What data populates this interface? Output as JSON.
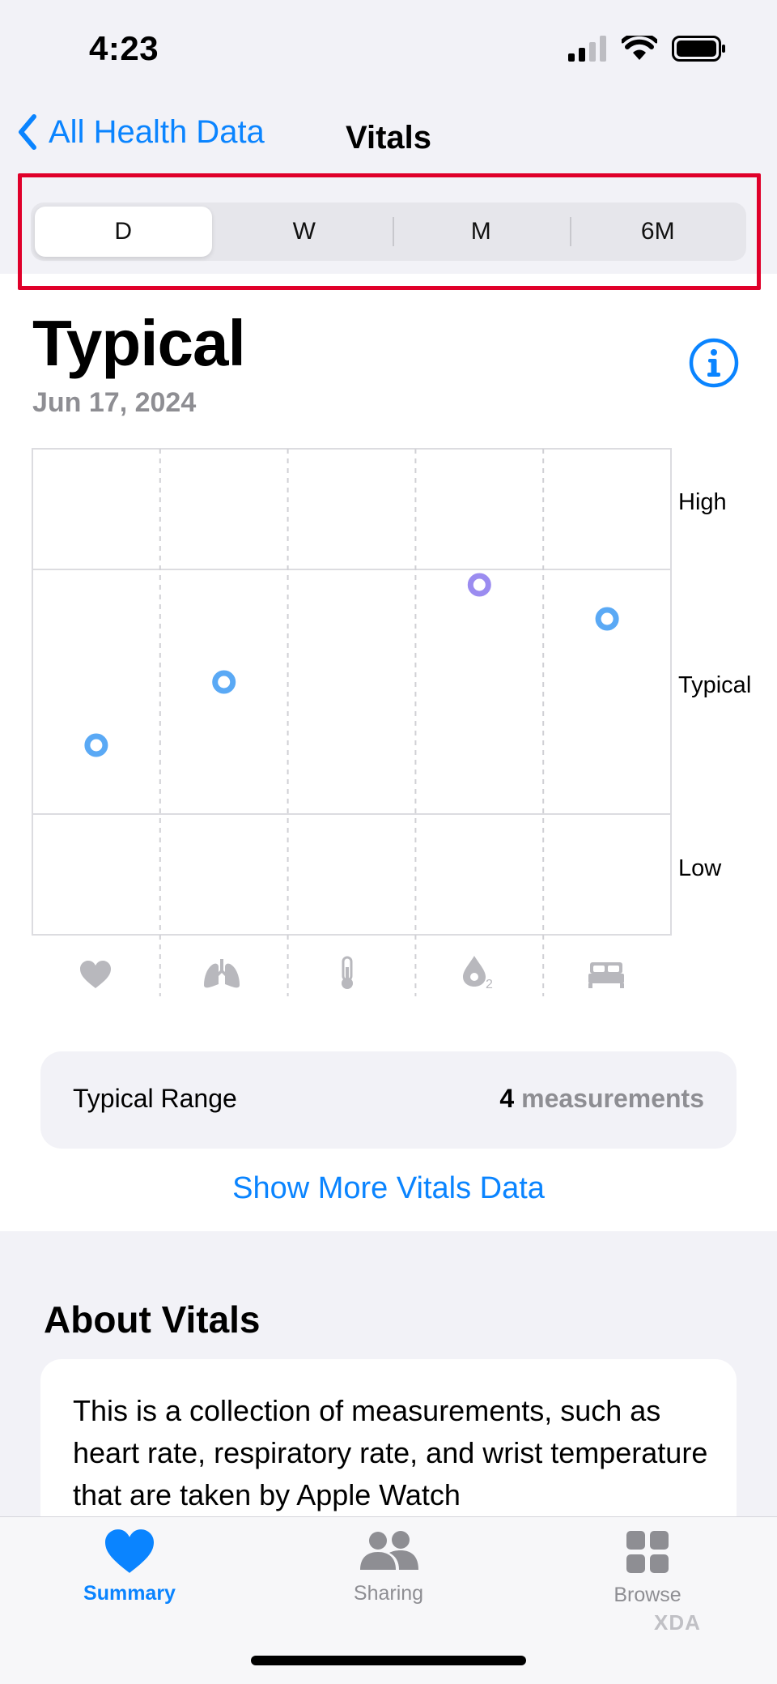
{
  "status_bar": {
    "time": "4:23"
  },
  "nav": {
    "back_label": "All Health Data",
    "title": "Vitals"
  },
  "segments": [
    "D",
    "W",
    "M",
    "6M"
  ],
  "selected_segment": "D",
  "header": {
    "title": "Typical",
    "date": "Jun 17, 2024"
  },
  "chart_data": {
    "type": "scatter",
    "y_bands": [
      "High",
      "Typical",
      "Low"
    ],
    "x_metrics": [
      "heart-rate",
      "respiratory-rate",
      "wrist-temperature",
      "blood-oxygen",
      "sleep-duration"
    ],
    "points": [
      {
        "metric": "heart-rate",
        "level": 0.39,
        "color": "#5aa9f5"
      },
      {
        "metric": "respiratory-rate",
        "level": 0.52,
        "color": "#5aa9f5"
      },
      {
        "metric": "blood-oxygen",
        "level": 0.72,
        "color": "#9b8cf0"
      },
      {
        "metric": "sleep-duration",
        "level": 0.65,
        "color": "#5aa9f5"
      }
    ],
    "grid": true
  },
  "typical_range": {
    "label": "Typical Range",
    "count": "4",
    "unit": "measurements"
  },
  "show_more": "Show More Vitals Data",
  "about": {
    "title": "About Vitals",
    "text": "This is a collection of measurements, such as heart rate, respiratory rate, and wrist temperature that are taken by Apple Watch"
  },
  "tabbar": {
    "items": [
      {
        "label": "Summary",
        "icon": "heart-fill-icon",
        "active": true
      },
      {
        "label": "Sharing",
        "icon": "people-icon",
        "active": false
      },
      {
        "label": "Browse",
        "icon": "grid-icon",
        "active": false
      }
    ]
  },
  "watermark": "XDA",
  "colors": {
    "accent": "#0a84ff",
    "highlight": "#e0002a",
    "point_blue": "#5aa9f5",
    "point_purple": "#9b8cf0"
  }
}
